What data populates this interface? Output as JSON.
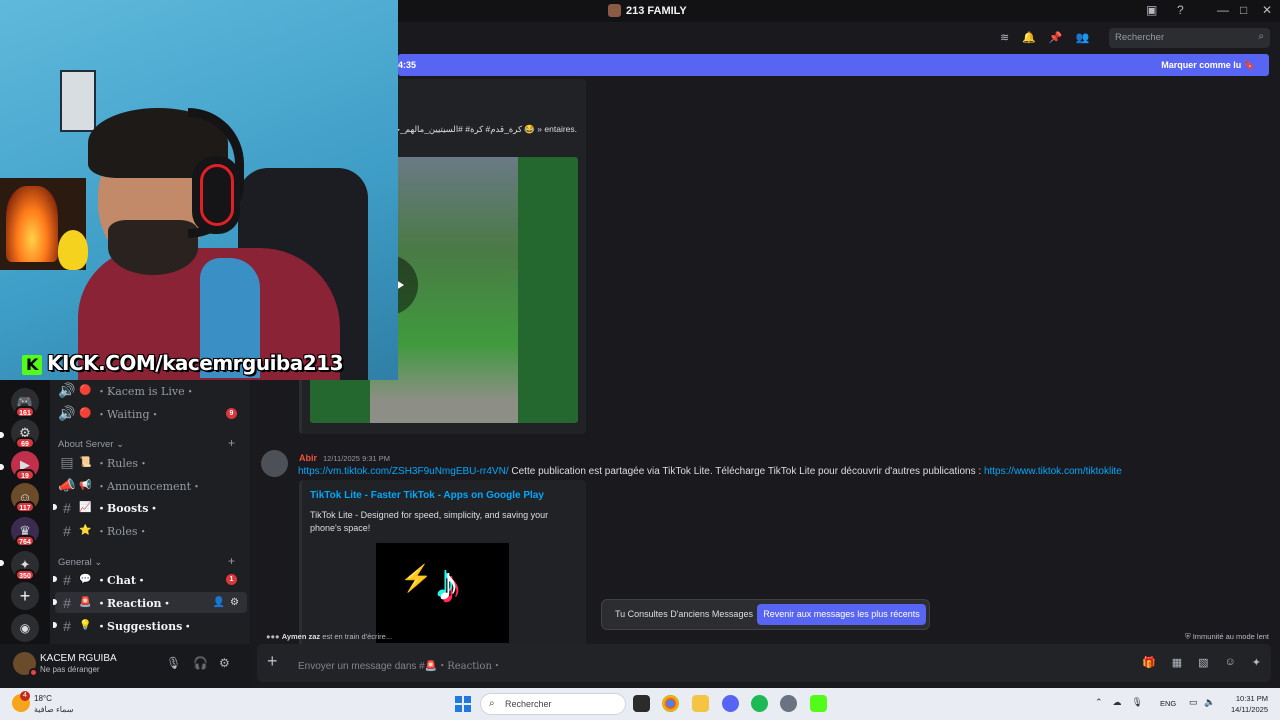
{
  "window": {
    "title": "213 FAMILY"
  },
  "header": {
    "search_placeholder": "Rechercher"
  },
  "new_messages_bar": {
    "time_fragment": "4:35",
    "mark_read": "Marquer comme lu"
  },
  "servers": [
    {
      "badge": "161"
    },
    {
      "badge": "69"
    },
    {
      "badge": "19"
    },
    {
      "badge": "117"
    },
    {
      "badge": "764"
    },
    {
      "badge": "350"
    }
  ],
  "sidebar": {
    "voice_channels": [
      {
        "emoji": "🔴",
        "name": "・Kacem is Live・"
      },
      {
        "emoji": "🔴",
        "name": "・Waiting・",
        "count": "9"
      }
    ],
    "categories": [
      {
        "name": "About Server ⌄",
        "channels": [
          {
            "emoji": "📜",
            "name": "・Rules・"
          },
          {
            "emoji": "📢",
            "name": "・Announcement・"
          },
          {
            "emoji": "📈",
            "name": "・Boosts・"
          },
          {
            "emoji": "⭐",
            "name": "・Roles・"
          }
        ]
      },
      {
        "name": "General ⌄",
        "channels": [
          {
            "emoji": "💬",
            "name": "・Chat・",
            "count": "1"
          },
          {
            "emoji": "🚨",
            "name": "・Reaction・"
          },
          {
            "emoji": "💡",
            "name": "・Suggestions・"
          }
        ]
      }
    ]
  },
  "user": {
    "name": "KACEM RGUIBA",
    "status": "Ne pas déranger"
  },
  "messages": {
    "first_partial": "« # كرة_قدم# كرة# #السيتيين_مالهم_حل 😂 » entaires.",
    "second": {
      "author": "Abir",
      "timestamp": "12/11/2025 9:31 PM",
      "link1": "https://vm.tiktok.com/ZSH3F9uNmgEBU-rr4VN/",
      "text": " Cette publication est partagée via TikTok Lite. Télécharge TikTok Lite pour découvrir d'autres publications : ",
      "link2": "https://www.tiktok.com/tiktoklite",
      "embed_title": "TikTok Lite - Faster TikTok - Apps on Google Play",
      "embed_desc": "TikTok Lite - Designed for speed, simplicity, and saving your phone's space!"
    }
  },
  "toast": {
    "text": "Tu Consultes D'anciens Messages",
    "button": "Revenir aux messages les plus récents"
  },
  "typing": {
    "user": "Aymen zaz",
    "text": " est en train d'écrire..."
  },
  "slowmode": "Immunité au mode lent",
  "composer": {
    "placeholder_prefix": "Envoyer un message dans #",
    "channel": "・Reaction・"
  },
  "stream_overlay": {
    "text": "KICK.COM/kacemrguiba213"
  },
  "taskbar": {
    "temperature": "18°C",
    "condition": "سماء صافية",
    "weather_badge": "4",
    "search_placeholder": "Rechercher",
    "lang": "ENG",
    "time": "10:31 PM",
    "date": "14/11/2025"
  },
  "colors": {
    "accent": "#5865f2",
    "link": "#00a8fc",
    "kick_green": "#53fc18"
  }
}
